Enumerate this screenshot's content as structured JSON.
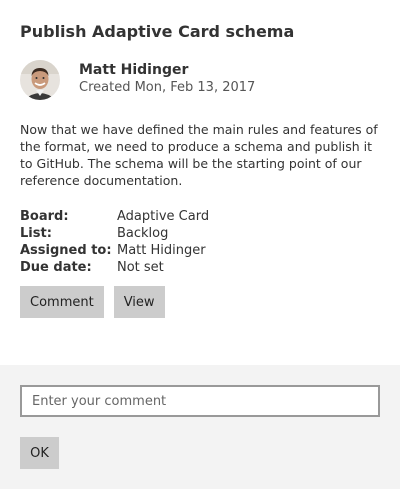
{
  "card": {
    "title": "Publish Adaptive Card schema",
    "author": {
      "name": "Matt Hidinger",
      "created": "Created Mon, Feb 13, 2017"
    },
    "description": "Now that we have defined the main rules and features of the format, we need to produce a schema and publish it to GitHub. The schema will be the starting point of our reference documentation.",
    "facts": [
      {
        "title": "Board:",
        "value": "Adaptive Card"
      },
      {
        "title": "List:",
        "value": "Backlog"
      },
      {
        "title": "Assigned to:",
        "value": "Matt Hidinger"
      },
      {
        "title": "Due date:",
        "value": "Not set"
      }
    ],
    "actions": {
      "comment_label": "Comment",
      "view_label": "View"
    }
  },
  "comment_panel": {
    "placeholder": "Enter your comment",
    "value": "",
    "ok_label": "OK"
  },
  "colors": {
    "button_bg": "#cccccc",
    "panel_bg": "#f3f3f3",
    "input_border": "#999999"
  }
}
